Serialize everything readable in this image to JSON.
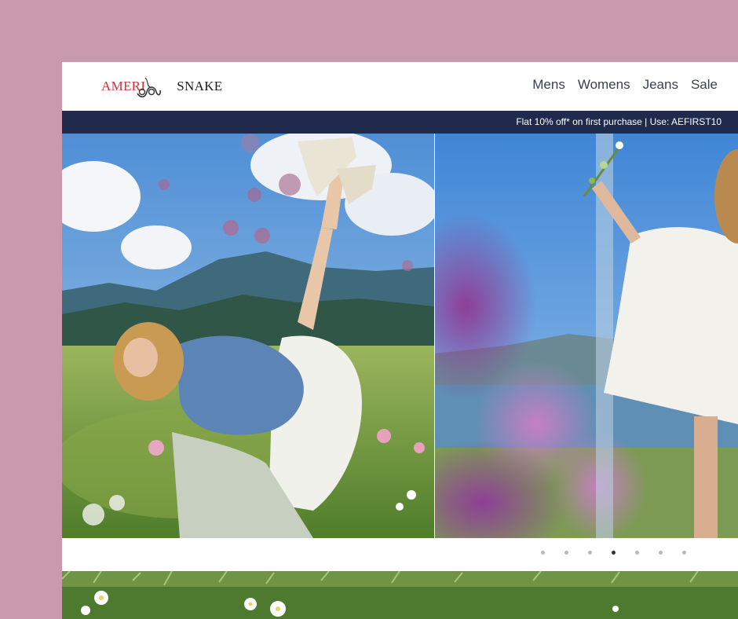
{
  "brand": {
    "logo_part1": "AMERI",
    "logo_part2": "SNAKE"
  },
  "nav": {
    "items": [
      "Mens",
      "Womens",
      "Jeans",
      "Sale"
    ]
  },
  "promo": {
    "text": "Flat 10% off* on first purchase | Use: AEFIRST10"
  },
  "carousel": {
    "slide_count": 7,
    "active_index": 3
  },
  "colors": {
    "page_background": "#c99aae",
    "promo_bar": "#1f2a4d",
    "logo_accent": "#d6303a"
  }
}
